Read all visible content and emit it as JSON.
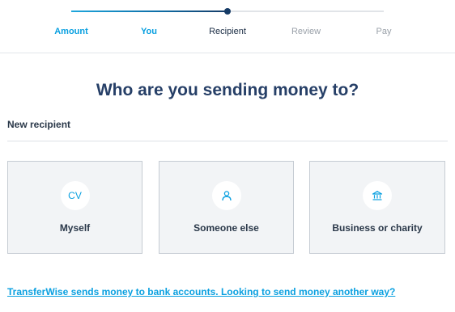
{
  "stepper": {
    "progress": 0.5,
    "steps": [
      {
        "label": "Amount",
        "state": "done"
      },
      {
        "label": "You",
        "state": "done"
      },
      {
        "label": "Recipient",
        "state": "current"
      },
      {
        "label": "Review",
        "state": "todo"
      },
      {
        "label": "Pay",
        "state": "todo"
      }
    ]
  },
  "main": {
    "title": "Who are you sending money to?",
    "section_label": "New recipient",
    "cards": [
      {
        "icon_text": "CV",
        "icon": "initials-avatar",
        "label": "Myself"
      },
      {
        "icon": "person-icon",
        "label": "Someone else"
      },
      {
        "icon": "bank-icon",
        "label": "Business or charity"
      }
    ],
    "footer_link": "TransferWise sends money to bank accounts. Looking to send money another way?"
  },
  "colors": {
    "accent": "#0aa0e0",
    "heading": "#263f67",
    "card_bg": "#f2f4f6",
    "card_border": "#c6ccd3"
  }
}
